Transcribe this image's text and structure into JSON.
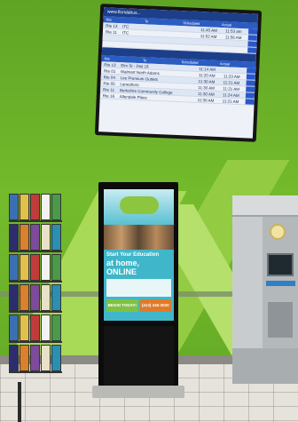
{
  "board": {
    "header_left": "www.floridabus...",
    "header_right": "",
    "col_route": "Rte",
    "col_dest": "To",
    "col_sched": "Scheduled",
    "col_actual": "Actual",
    "rows_top": [
      {
        "route": "Rte 13",
        "dest": "ITC",
        "time": "11:45 AM",
        "actual": "11:53 am"
      },
      {
        "route": "Rte 11",
        "dest": "ITC",
        "time": "11:52 AM",
        "actual": "11:56 AM"
      },
      {
        "route": "",
        "dest": "",
        "time": "",
        "actual": ""
      },
      {
        "route": "",
        "dest": "",
        "time": "",
        "actual": ""
      }
    ],
    "rows_bottom": [
      {
        "route": "Rte 13",
        "dest": "Elm St - Dist 16",
        "time": "11:14 AM",
        "actual": ""
      },
      {
        "route": "Rte 01",
        "dest": "Walmart North Adams",
        "time": "11:20 AM",
        "actual": "11:23 AM"
      },
      {
        "route": "Rte 04",
        "dest": "Lee Premium Outlets",
        "time": "11:30 AM",
        "actual": "11:21 AM"
      },
      {
        "route": "Rte 05",
        "dest": "Lanesboro",
        "time": "11:30 AM",
        "actual": "11:21 AM"
      },
      {
        "route": "Rte 11",
        "dest": "Berkshire Community College",
        "time": "11:30 AM",
        "actual": "11:24 AM"
      },
      {
        "route": "Rte 16",
        "dest": "Allendale Place",
        "time": "11:30 AM",
        "actual": "11:21 AM"
      }
    ]
  },
  "kiosk": {
    "headline_line1": "Start Your Education",
    "headline_line2": "at home, ONLINE",
    "cta_label": "BEGIN TODAY!",
    "phone_label": "(413) 345-3020"
  },
  "colors": {
    "wall": "#6fb52a",
    "board_blue": "#1d3f8a",
    "kiosk_teal": "#3fb6c9",
    "cta_green": "#7fc241"
  }
}
